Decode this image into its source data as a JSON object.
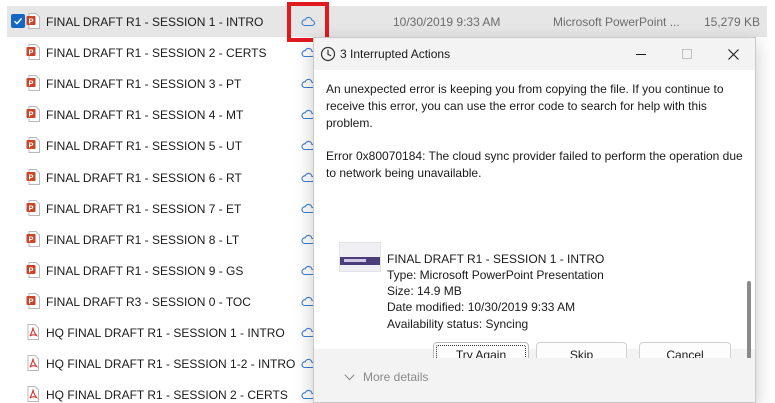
{
  "files": [
    {
      "name": "FINAL DRAFT R1 - SESSION 1 - INTRO",
      "icon": "powerpoint-icon",
      "date": "10/30/2019 9:33 AM",
      "type": "Microsoft PowerPoint ...",
      "size": "15,279 KB",
      "selected": true
    },
    {
      "name": "FINAL DRAFT R1 - SESSION 2 - CERTS",
      "icon": "powerpoint-icon"
    },
    {
      "name": "FINAL DRAFT R1 - SESSION 3 - PT",
      "icon": "powerpoint-icon"
    },
    {
      "name": "FINAL DRAFT R1 - SESSION 4 - MT",
      "icon": "powerpoint-icon"
    },
    {
      "name": "FINAL DRAFT R1 - SESSION 5 - UT",
      "icon": "powerpoint-icon"
    },
    {
      "name": "FINAL DRAFT R1 - SESSION 6 - RT",
      "icon": "powerpoint-icon"
    },
    {
      "name": "FINAL DRAFT R1 - SESSION 7 - ET",
      "icon": "powerpoint-icon"
    },
    {
      "name": "FINAL DRAFT R1 - SESSION 8 - LT",
      "icon": "powerpoint-icon"
    },
    {
      "name": "FINAL DRAFT R1 - SESSION 9 - GS",
      "icon": "powerpoint-icon"
    },
    {
      "name": "FINAL DRAFT R3 - SESSION 0 - TOC",
      "icon": "powerpoint-icon"
    },
    {
      "name": "HQ FINAL DRAFT R1 - SESSION 1 - INTRO",
      "icon": "pdf-icon"
    },
    {
      "name": "HQ FINAL DRAFT R1 - SESSION 1-2 - INTRO",
      "icon": "pdf-icon"
    },
    {
      "name": "HQ FINAL DRAFT R1 - SESSION 2 - CERTS",
      "icon": "pdf-icon"
    }
  ],
  "dialog": {
    "title": "3 Interrupted Actions",
    "message": "An unexpected error is keeping you from copying the file. If you continue to receive this error, you can use the error code to search for help with this problem.",
    "error": "Error 0x80070184: The cloud sync provider failed to perform the operation due to network being unavailable.",
    "file_name": "FINAL DRAFT R1 - SESSION 1 - INTRO",
    "file_type": "Type: Microsoft PowerPoint Presentation",
    "file_size": "Size: 14.9 MB",
    "file_modified": "Date modified: 10/30/2019 9:33 AM",
    "file_availability": "Availability status: Syncing",
    "try_again_label": "Try Again",
    "skip_label": "Skip",
    "cancel_label": "Cancel",
    "more_details_label": "More details"
  },
  "colors": {
    "selection": "#e6e6e6",
    "checkbox": "#1566c0",
    "powerpoint": "#c8452a",
    "pdf": "#d7322b",
    "highlight": "#e0191f",
    "cloud": "#3a7fd0"
  }
}
